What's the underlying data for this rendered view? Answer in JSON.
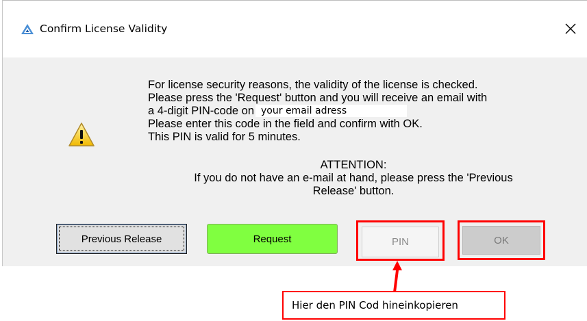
{
  "window": {
    "title": "Confirm License Validity",
    "close_glyph": "✕"
  },
  "message": {
    "line1": "For license security reasons, the validity of the license is checked.",
    "line2": "Please press the 'Request' button and you will receive an email with",
    "line3_prefix": "a 4-digit PIN-code on",
    "email_value": "your email adress",
    "line4": "Please enter this code in the field and confirm with OK.",
    "line5": "This PIN is valid for 5 minutes."
  },
  "attention": {
    "heading": "ATTENTION:",
    "line1": "If you do not have an e-mail at hand, please press the 'Previous",
    "line2": "Release' button."
  },
  "buttons": {
    "previous_release": "Previous Release",
    "request": "Request",
    "pin": "PIN",
    "ok": "OK"
  },
  "annotation": {
    "callout_text": "Hier den PIN Cod hineinkopieren",
    "color": "#ff0000"
  },
  "colors": {
    "request_button": "#80ff40",
    "dialog_bg": "#f0f0f0"
  },
  "icons": {
    "title": "app-logo-icon",
    "warning": "warning-icon",
    "close": "close-icon"
  }
}
